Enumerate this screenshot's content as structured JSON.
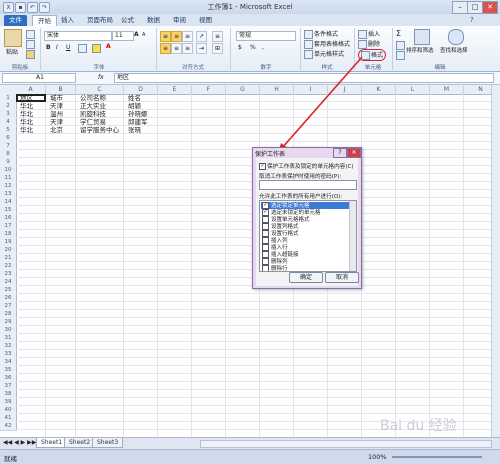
{
  "window": {
    "title": "工作簿1 - Microsoft Excel",
    "minimize": "–",
    "restore": "□",
    "close": "✕"
  },
  "tabs": [
    {
      "label": "文件"
    },
    {
      "label": "开始"
    },
    {
      "label": "插入"
    },
    {
      "label": "页面布局"
    },
    {
      "label": "公式"
    },
    {
      "label": "数据"
    },
    {
      "label": "审阅"
    },
    {
      "label": "视图"
    }
  ],
  "ribbon": {
    "clipboard": {
      "paste": "粘贴",
      "group": "剪贴板"
    },
    "font": {
      "name": "宋体",
      "size": "11",
      "bold": "B",
      "italic": "I",
      "underline": "U",
      "font_color": "A",
      "grow": "A",
      "shrink": "A",
      "group": "字体"
    },
    "alignment": {
      "wrap": "≡",
      "group": "对齐方式"
    },
    "number": {
      "format": "常规",
      "percent": "%",
      "comma": ",",
      "currency": "$",
      "group": "数字"
    },
    "styles": {
      "conditional": "条件格式",
      "table": "套用表格格式",
      "cell": "单元格样式",
      "group": "样式"
    },
    "cells": {
      "insert": "插入",
      "delete": "删除",
      "format": "格式",
      "group": "单元格"
    },
    "editing": {
      "sum": "Σ",
      "sort": "排序和筛选",
      "find": "查找和选择",
      "group": "编辑"
    }
  },
  "formula_bar": {
    "name_box": "A1",
    "fx": "fx",
    "value": "地区"
  },
  "columns": [
    "A",
    "B",
    "C",
    "D",
    "E",
    "F",
    "G",
    "H",
    "I",
    "J",
    "K",
    "L",
    "M",
    "N"
  ],
  "rows": [
    "1",
    "2",
    "3",
    "4",
    "5",
    "6",
    "7",
    "8",
    "9",
    "10",
    "11",
    "12",
    "13",
    "14",
    "15",
    "16",
    "17",
    "18",
    "19",
    "20",
    "21",
    "22",
    "23",
    "24",
    "25",
    "26",
    "27",
    "28",
    "29",
    "30",
    "31",
    "32",
    "33",
    "34",
    "35",
    "36",
    "37",
    "38",
    "39",
    "40",
    "41",
    "42"
  ],
  "cells": [
    [
      "地区",
      "城市",
      "公司名称",
      "姓名"
    ],
    [
      "华北",
      "天津",
      "正大实业",
      "胡颖"
    ],
    [
      "华北",
      "温州",
      "凯旋科技",
      "孙晓娜"
    ],
    [
      "华北",
      "天津",
      "学仁贸易",
      "邱建军"
    ],
    [
      "华北",
      "北京",
      "留学服务中心",
      "张晓"
    ]
  ],
  "sheets": [
    {
      "label": "Sheet1"
    },
    {
      "label": "Sheet2"
    },
    {
      "label": "Sheet3"
    }
  ],
  "status": {
    "ready": "就绪",
    "zoom": "100%"
  },
  "dialog": {
    "title": "保护工作表",
    "help": "?",
    "close": "✕",
    "protect_label": "保护工作表及锁定的单元格内容(C)",
    "password_label": "取消工作表保护时使用的密码(P):",
    "allow_label": "允许此工作表的所有用户进行(O):",
    "items": [
      {
        "label": "选定锁定单元格",
        "checked": true
      },
      {
        "label": "选定未锁定的单元格",
        "checked": true
      },
      {
        "label": "设置单元格格式",
        "checked": false
      },
      {
        "label": "设置列格式",
        "checked": false
      },
      {
        "label": "设置行格式",
        "checked": false
      },
      {
        "label": "插入列",
        "checked": false
      },
      {
        "label": "插入行",
        "checked": false
      },
      {
        "label": "插入超链接",
        "checked": false
      },
      {
        "label": "删除列",
        "checked": false
      },
      {
        "label": "删除行",
        "checked": false
      }
    ],
    "ok": "确定",
    "cancel": "取消"
  },
  "watermark": "Bai du 经验"
}
